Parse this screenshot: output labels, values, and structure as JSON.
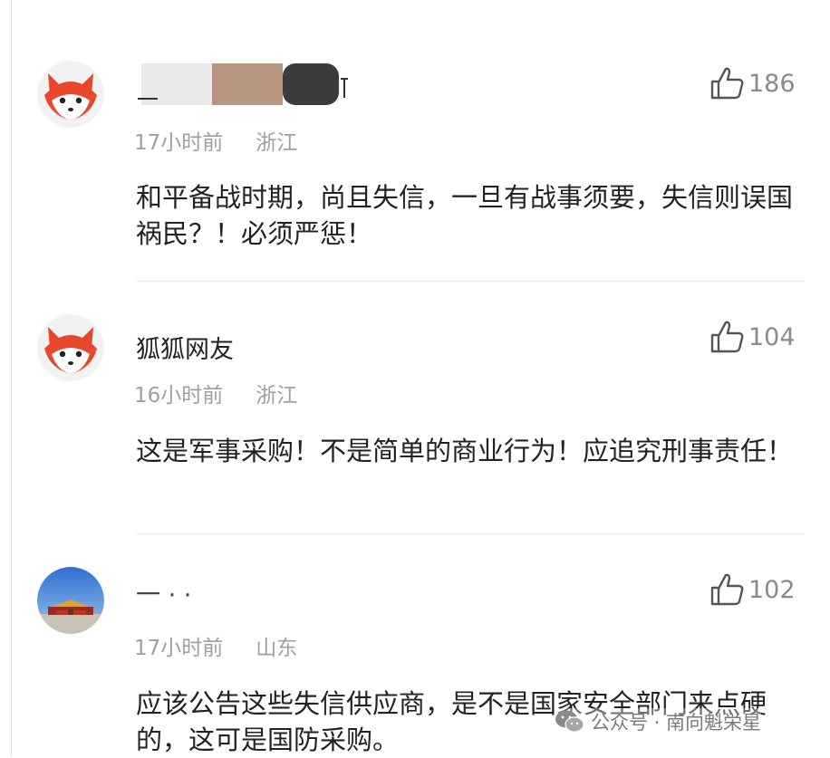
{
  "comments": [
    {
      "user": "",
      "time": "17小时前",
      "location": "浙江",
      "likes": "186",
      "text": "和平备战时期，尚且失信，一旦有战事须要，失信则误国祸民？！必须严惩！"
    },
    {
      "user": "狐狐网友",
      "time": "16小时前",
      "location": "浙江",
      "likes": "104",
      "text": "这是军事采购！不是简单的商业行为！应追究刑事责任！"
    },
    {
      "user": "一 · ·",
      "time": "17小时前",
      "location": "山东",
      "likes": "102",
      "text": "应该公告这些失信供应商，是不是国家安全部门来点硬的，这可是国防采购。"
    }
  ],
  "icons": [
    "fox-avatar-icon",
    "thumbs-up-icon",
    "wechat-icon"
  ],
  "colors": {
    "fox_orange": "#e8472b",
    "meta_gray": "#a0a0a0",
    "text": "#222222"
  },
  "watermark": {
    "text": "公众号 · 南向魁栄星"
  }
}
